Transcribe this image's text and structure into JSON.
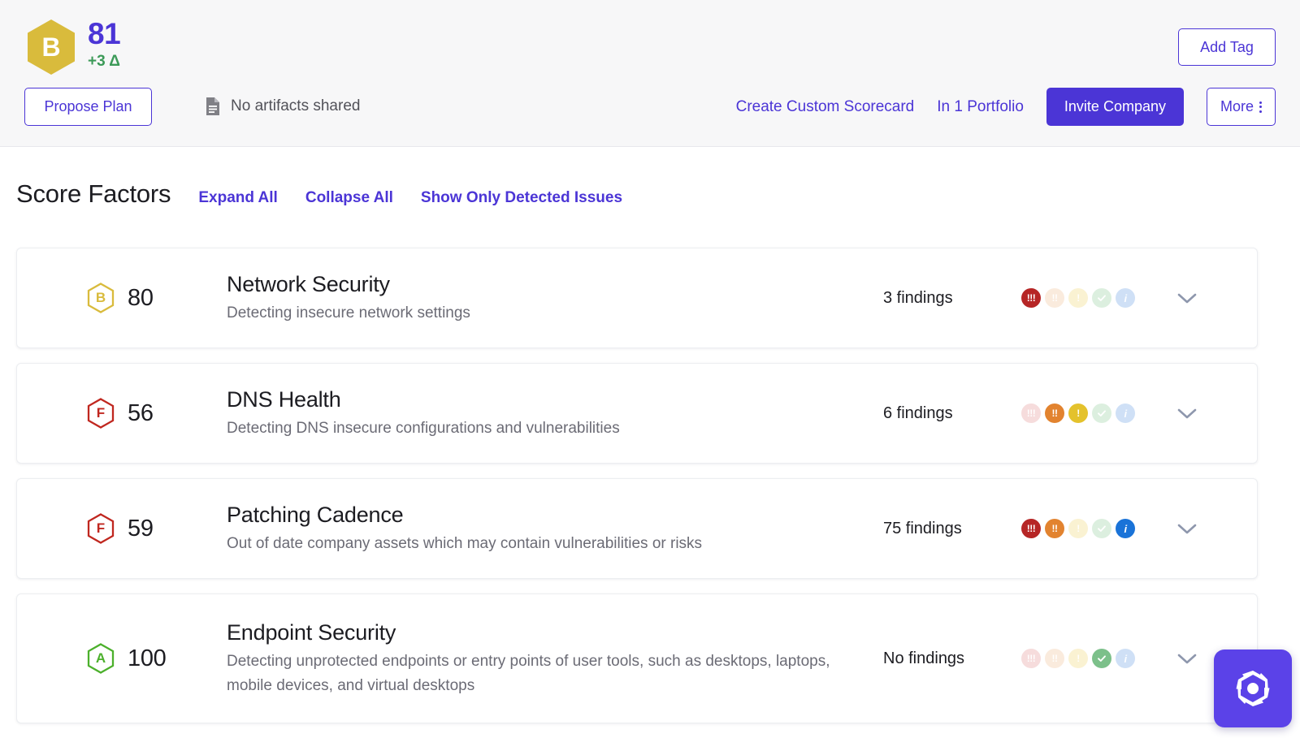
{
  "header": {
    "grade_letter": "B",
    "grade_color": "#d9bb3c",
    "score": "81",
    "score_color": "#4b35d6",
    "delta": "+3 Δ",
    "delta_color": "#3c9a58",
    "propose_plan_label": "Propose Plan",
    "artifacts_icon": "document-icon",
    "artifacts_label": "No artifacts shared",
    "add_tag_label": "Add Tag",
    "create_scorecard_label": "Create Custom Scorecard",
    "portfolio_label": "In 1 Portfolio",
    "invite_label": "Invite Company",
    "more_label": "More",
    "more_icon": "kebab-menu-icon",
    "accent_color": "#4b35d6"
  },
  "section": {
    "title": "Score Factors",
    "links": [
      {
        "label": "Expand All",
        "name": "expand-all-link"
      },
      {
        "label": "Collapse All",
        "name": "collapse-all-link"
      },
      {
        "label": "Show Only Detected Issues",
        "name": "show-only-detected-issues-link"
      }
    ]
  },
  "severity_legend": [
    {
      "key": "high",
      "glyph": "!!!",
      "on_color": "#b62626",
      "off_color": "#f6dcdc"
    },
    {
      "key": "medium",
      "glyph": "!!",
      "on_color": "#e2832f",
      "off_color": "#faebdd"
    },
    {
      "key": "low",
      "glyph": "!",
      "on_color": "#e4c22c",
      "off_color": "#faf2d2"
    },
    {
      "key": "positive",
      "glyph": "check",
      "on_color": "#7cc08a",
      "off_color": "#dcefdf"
    },
    {
      "key": "info",
      "glyph": "i",
      "on_color": "#1a73d8",
      "off_color": "#cfe0f6"
    }
  ],
  "factors": [
    {
      "grade_letter": "B",
      "grade_color": "#d9bb3c",
      "score": "80",
      "name": "Network Security",
      "description": "Detecting insecure network settings",
      "findings": "3 findings",
      "severities": [
        true,
        false,
        false,
        false,
        false
      ],
      "chevron": "chevron-down-icon"
    },
    {
      "grade_letter": "F",
      "grade_color": "#c0271f",
      "score": "56",
      "name": "DNS Health",
      "description": "Detecting DNS insecure configurations and vulnerabilities",
      "findings": "6 findings",
      "severities": [
        false,
        true,
        true,
        false,
        false
      ],
      "chevron": "chevron-down-icon"
    },
    {
      "grade_letter": "F",
      "grade_color": "#c0271f",
      "score": "59",
      "name": "Patching Cadence",
      "description": "Out of date company assets which may contain vulnerabilities or risks",
      "findings": "75 findings",
      "severities": [
        true,
        true,
        false,
        false,
        true
      ],
      "chevron": "chevron-down-icon"
    },
    {
      "grade_letter": "A",
      "grade_color": "#4cb02c",
      "score": "100",
      "name": "Endpoint Security",
      "description": "Detecting unprotected endpoints or entry points of user tools, such as desktops, laptops, mobile devices, and virtual desktops",
      "findings": "No findings",
      "severities": [
        false,
        false,
        false,
        true,
        false
      ],
      "chevron": "chevron-down-icon"
    }
  ],
  "fab": {
    "icon": "hexagon-aperture-logo-icon",
    "color": "#5b42e8"
  }
}
